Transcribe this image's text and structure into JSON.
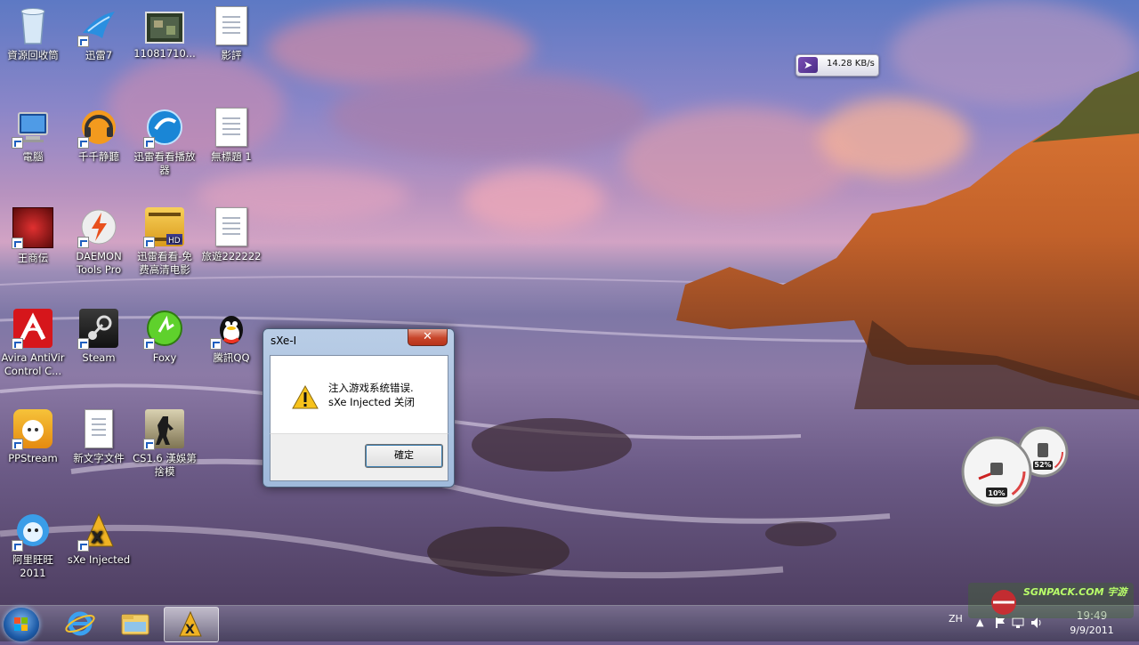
{
  "desktop": {
    "icons": [
      {
        "label": "資源回收筒",
        "icon": "recycle-bin-icon"
      },
      {
        "label": "電腦",
        "icon": "computer-icon"
      },
      {
        "label": "王商伝",
        "icon": "game-red-icon"
      },
      {
        "label": "Avira AntiVir Control C...",
        "icon": "avira-icon"
      },
      {
        "label": "PPStream",
        "icon": "ppstream-icon"
      },
      {
        "label": "阿里旺旺 2011",
        "icon": "aliwangwang-icon"
      },
      {
        "label": "迅雷7",
        "icon": "xunlei-icon"
      },
      {
        "label": "千千静聽",
        "icon": "ttplayer-icon"
      },
      {
        "label": "DAEMON Tools Pro",
        "icon": "daemon-tools-icon"
      },
      {
        "label": "Steam",
        "icon": "steam-icon"
      },
      {
        "label": "新文字文件",
        "icon": "text-document-icon"
      },
      {
        "label": "sXe Injected",
        "icon": "sxe-icon"
      },
      {
        "label": "11081710...",
        "icon": "image-thumbnail-icon"
      },
      {
        "label": "迅雷看看播放器",
        "icon": "xunlei-player-icon"
      },
      {
        "label": "迅雷看看-免费高清电影",
        "icon": "xunlei-hd-icon"
      },
      {
        "label": "Foxy",
        "icon": "foxy-icon"
      },
      {
        "label": "CS1.6 漢娛第 捨模",
        "icon": "counter-strike-icon"
      },
      {
        "label": "影評",
        "icon": "document-icon"
      },
      {
        "label": "無標題 1",
        "icon": "document-icon"
      },
      {
        "label": "旅遊222222",
        "icon": "document-icon"
      },
      {
        "label": "騰訊QQ",
        "icon": "qq-icon"
      }
    ]
  },
  "network_gadget": {
    "speed": "14.28 KB/s"
  },
  "cpu_gadget": {
    "cpu": "10%",
    "ram": "52%"
  },
  "dialog": {
    "title": "sXe-I",
    "close": "✕",
    "message_line1": "注入游戏系统错误.",
    "message_line2": "sXe Injected 关闭",
    "ok_button": "確定"
  },
  "taskbar": {
    "pinned": [
      "internet-explorer-icon",
      "file-explorer-icon",
      "sxe-injected-icon"
    ],
    "language": "ZH",
    "time": "19:49",
    "date": "9/9/2011"
  },
  "watermark": "SGNPACK.COM 宇游"
}
